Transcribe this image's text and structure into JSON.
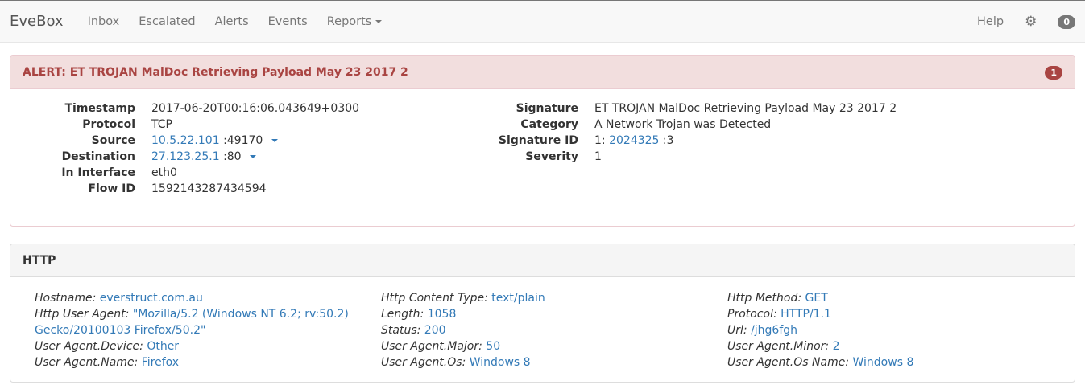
{
  "nav": {
    "brand": "EveBox",
    "items": [
      "Inbox",
      "Escalated",
      "Alerts",
      "Events",
      "Reports"
    ],
    "help": "Help",
    "badge": "0"
  },
  "alert": {
    "title": "ALERT: ET TROJAN MalDoc Retrieving Payload May 23 2017 2",
    "count": "1",
    "left": {
      "timestamp_label": "Timestamp",
      "timestamp": "2017-06-20T00:16:06.043649+0300",
      "protocol_label": "Protocol",
      "protocol": "TCP",
      "source_label": "Source",
      "source_ip": "10.5.22.101",
      "source_port": ":49170",
      "destination_label": "Destination",
      "destination_ip": "27.123.25.1",
      "destination_port": ":80",
      "in_interface_label": "In Interface",
      "in_interface": "eth0",
      "flow_id_label": "Flow ID",
      "flow_id": "1592143287434594"
    },
    "right": {
      "signature_label": "Signature",
      "signature": "ET TROJAN MalDoc Retrieving Payload May 23 2017 2",
      "category_label": "Category",
      "category": "A Network Trojan was Detected",
      "signature_id_label": "Signature ID",
      "sid_prefix": "1:",
      "sid": "2024325",
      "sid_suffix": ":3",
      "severity_label": "Severity",
      "severity": "1"
    }
  },
  "http": {
    "title": "HTTP",
    "col1": [
      {
        "k": "Hostname:",
        "v": "everstruct.com.au"
      },
      {
        "k": "Http User Agent:",
        "v": "\"Mozilla/5.2 (Windows NT 6.2; rv:50.2) Gecko/20100103 Firefox/50.2\""
      },
      {
        "k": "User Agent.Device:",
        "v": "Other"
      },
      {
        "k": "User Agent.Name:",
        "v": "Firefox"
      }
    ],
    "col2": [
      {
        "k": "Http Content Type:",
        "v": "text/plain"
      },
      {
        "k": "Length:",
        "v": "1058"
      },
      {
        "k": "Status:",
        "v": "200"
      },
      {
        "k": "User Agent.Major:",
        "v": "50"
      },
      {
        "k": "User Agent.Os:",
        "v": "Windows 8"
      }
    ],
    "col3": [
      {
        "k": "Http Method:",
        "v": "GET"
      },
      {
        "k": "Protocol:",
        "v": "HTTP/1.1"
      },
      {
        "k": "Url:",
        "v": "/jhg6fgh"
      },
      {
        "k": "User Agent.Minor:",
        "v": "2"
      },
      {
        "k": "User Agent.Os Name:",
        "v": "Windows 8"
      }
    ]
  }
}
